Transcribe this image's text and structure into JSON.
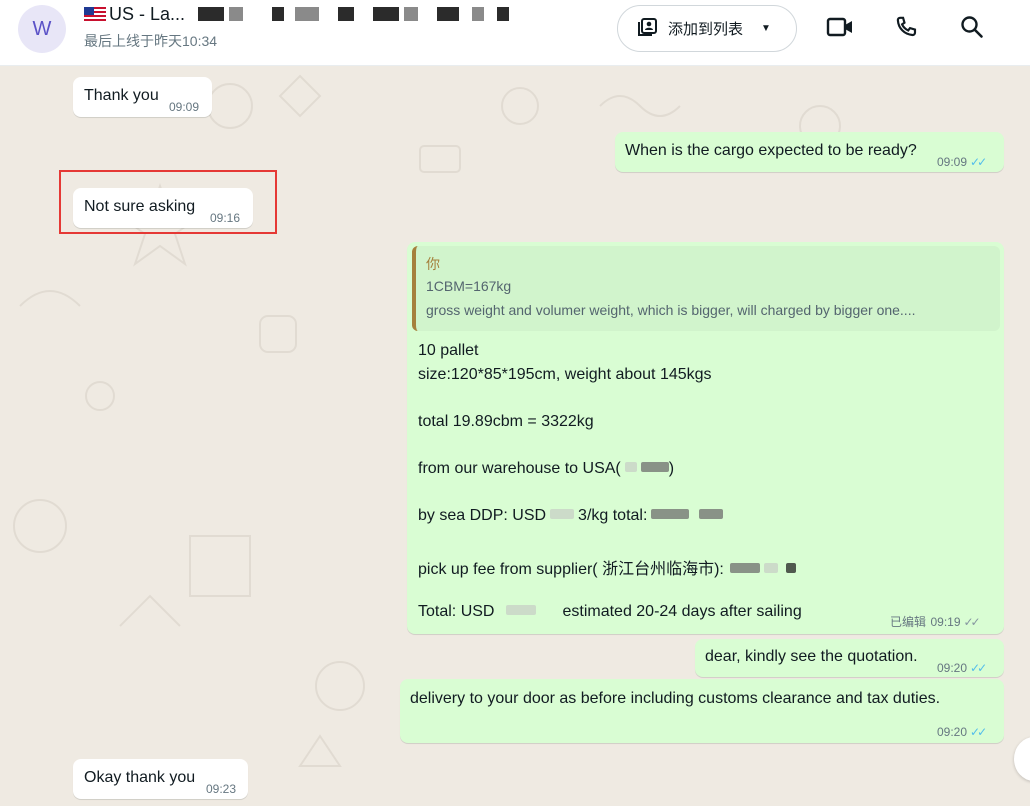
{
  "header": {
    "avatar_letter": "W",
    "contact_name": "US - La...",
    "last_seen": "最后上线于昨天10:34",
    "add_to_list_label": "添加到列表"
  },
  "messages": [
    {
      "id": "m1",
      "direction": "in",
      "text": "Thank you",
      "time": "09:09"
    },
    {
      "id": "m2",
      "direction": "out",
      "text": "When is the cargo expected to be ready?",
      "time": "09:09",
      "status": "read"
    },
    {
      "id": "m3",
      "direction": "in",
      "text": "Not sure asking",
      "time": "09:16",
      "highlighted": true
    },
    {
      "id": "m4",
      "direction": "out",
      "quote": {
        "author": "你",
        "line1": "1CBM=167kg",
        "line2": "gross weight and volumer weight, which is bigger, will charged by bigger one...."
      },
      "lines": {
        "l1": "10 pallet",
        "l2": "size:120*85*195cm, weight about 145kgs",
        "l3": "total 19.89cbm = 3322kg",
        "l4": "from our warehouse to USA(",
        "l4b": ")",
        "l5a": "by sea DDP: USD",
        "l5b": "3/kg  total:",
        "l6": "pick up fee from supplier( 浙江台州临海市):",
        "l7a": "Total: USD",
        "l7b": "estimated 20-24 days after sailing"
      },
      "edited_label": "已编辑",
      "time": "09:19",
      "status": "delivered"
    },
    {
      "id": "m5",
      "direction": "out",
      "text": "dear, kindly see the quotation.",
      "time": "09:20",
      "status": "read"
    },
    {
      "id": "m6",
      "direction": "out",
      "text": "delivery to your door as before including customs clearance and tax duties.",
      "time": "09:20",
      "status": "read"
    },
    {
      "id": "m7",
      "direction": "in",
      "text": "Okay thank you",
      "time": "09:23"
    }
  ],
  "colors": {
    "incoming_bubble": "#ffffff",
    "outgoing_bubble": "#d9fdd3",
    "read_tick": "#53bdeb",
    "highlight_box": "#e53935",
    "chat_background": "#efeae2"
  },
  "icons": {
    "list": "contact-list-icon",
    "video": "video-call-icon",
    "phone": "voice-call-icon",
    "search": "search-icon"
  }
}
